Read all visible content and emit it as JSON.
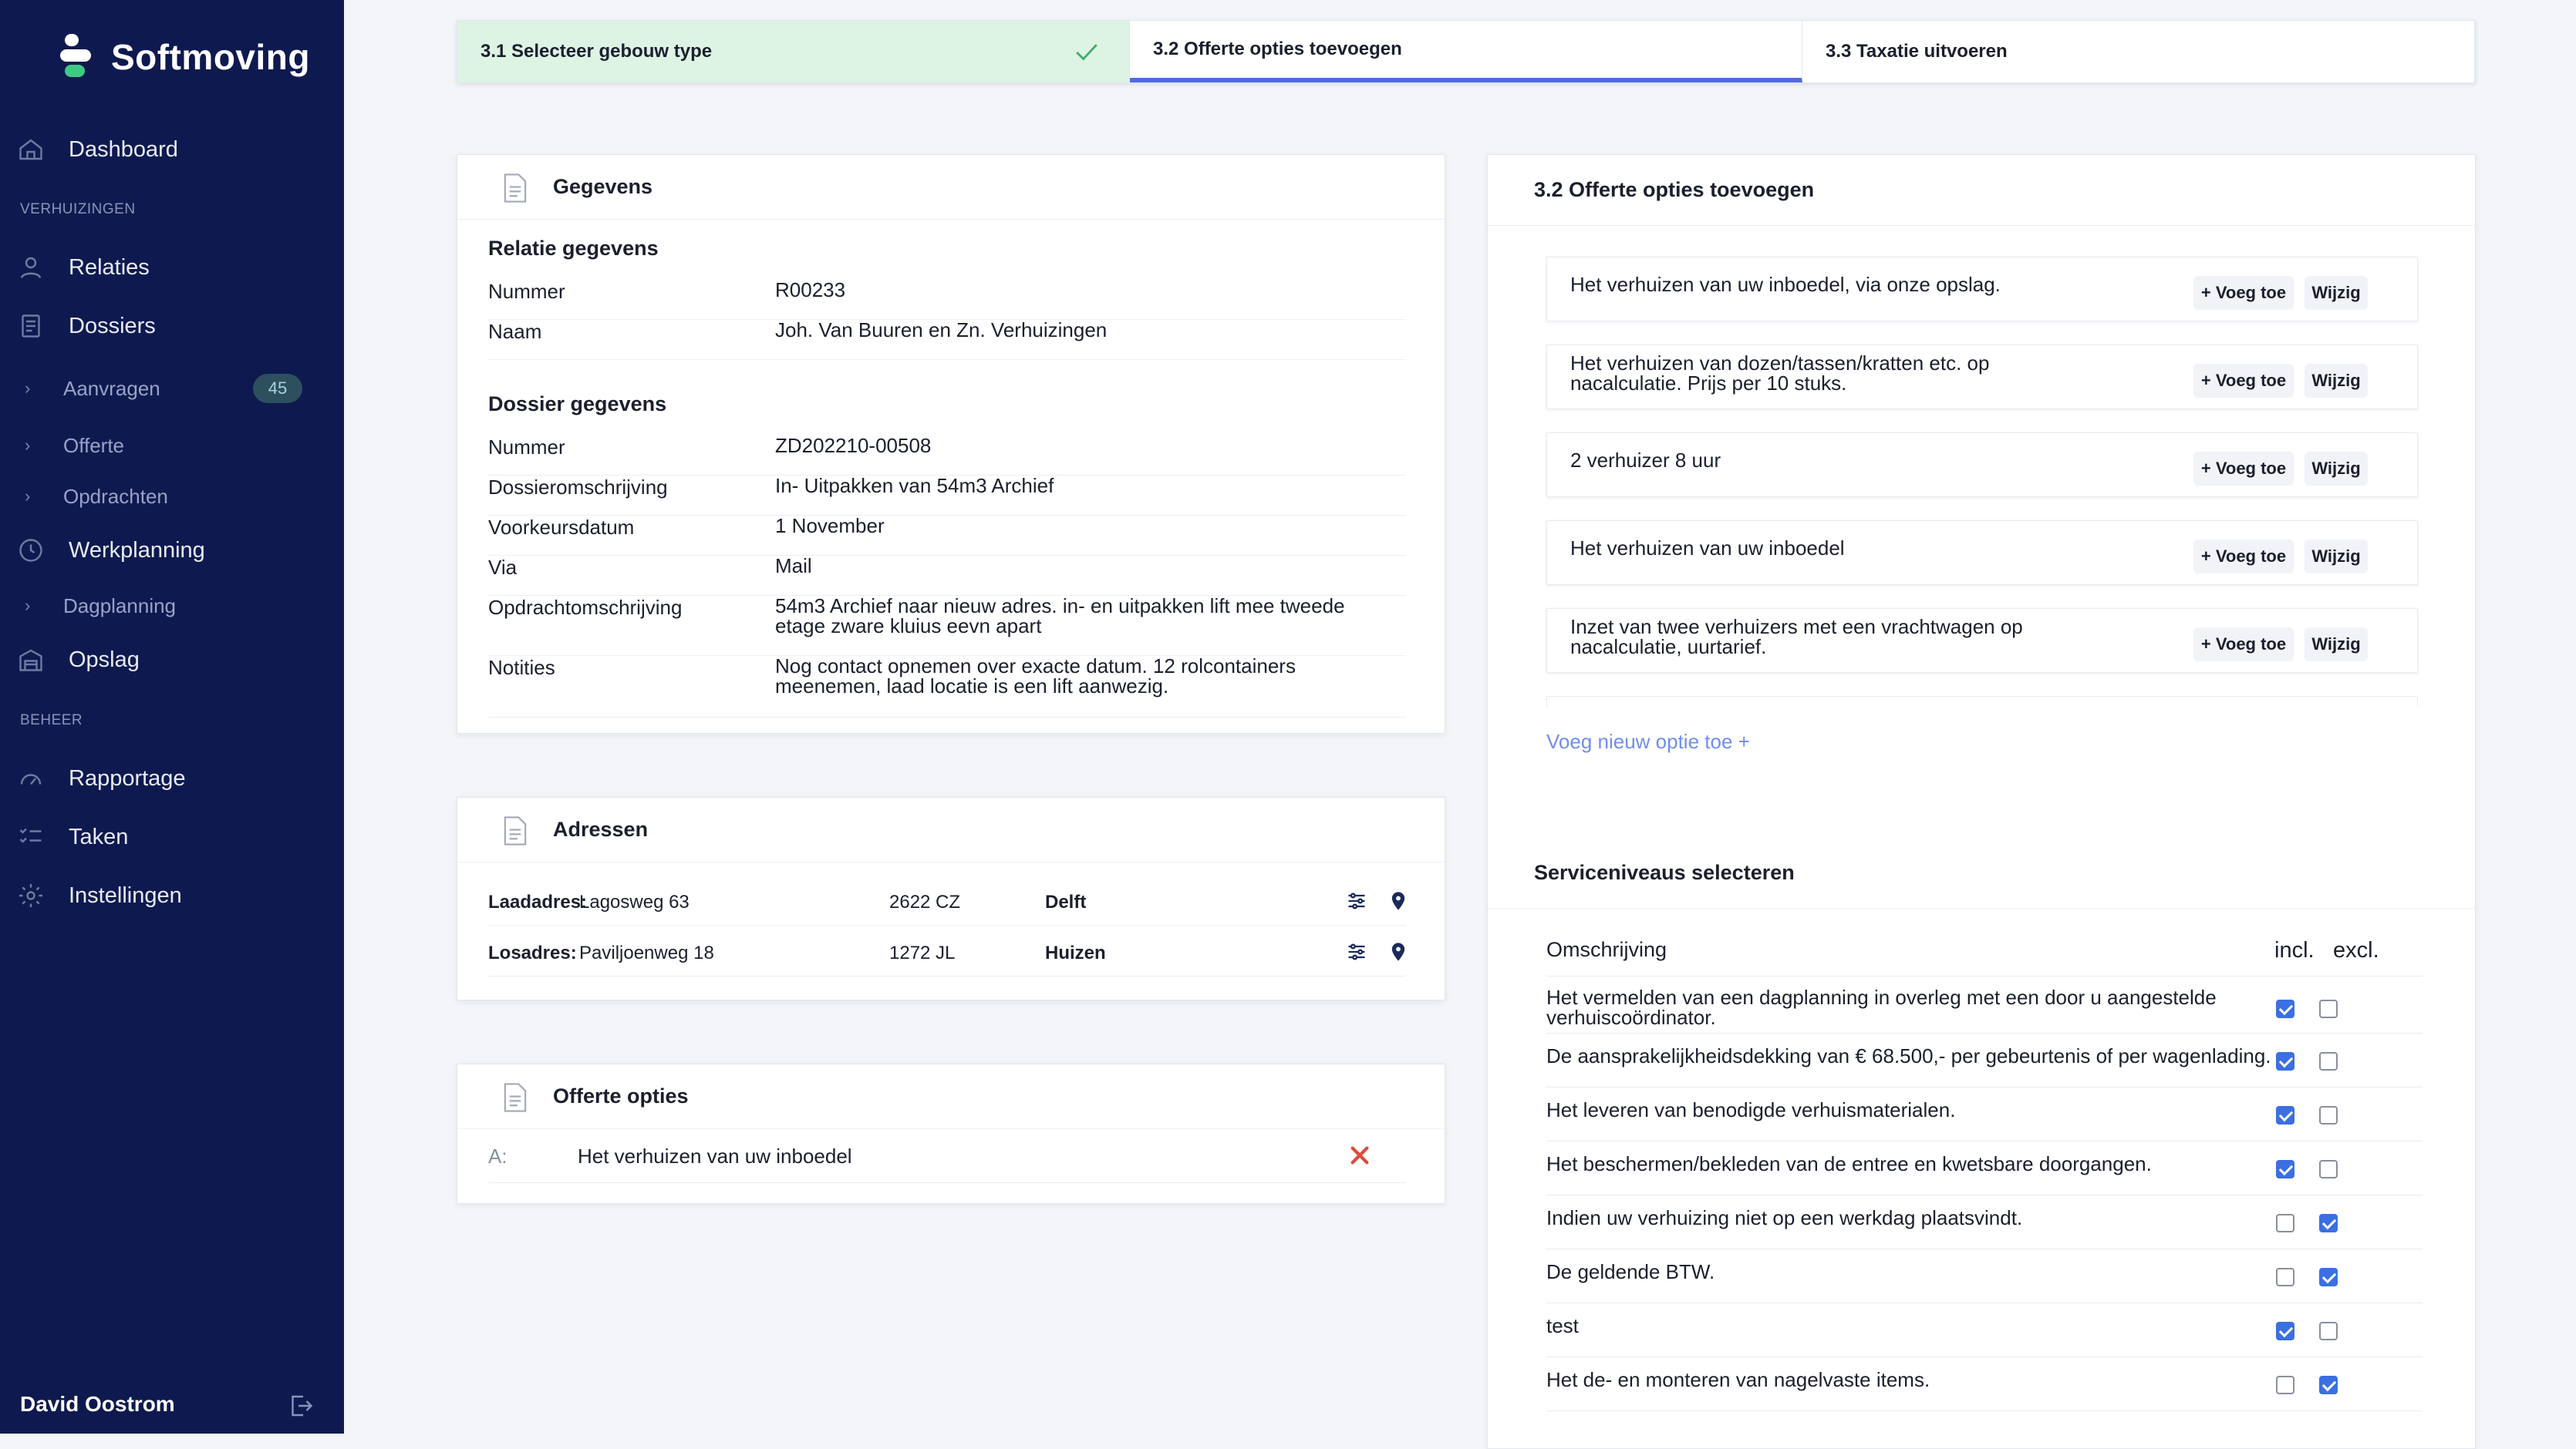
{
  "app": {
    "name": "Softmoving"
  },
  "sidebar": {
    "dashboard": "Dashboard",
    "section_verhuizingen": "VERHUIZINGEN",
    "relaties": "Relaties",
    "dossiers": "Dossiers",
    "aanvragen": "Aanvragen",
    "aanvragen_count": "45",
    "offerte": "Offerte",
    "opdrachten": "Opdrachten",
    "werkplanning": "Werkplanning",
    "dagplanning": "Dagplanning",
    "opslag": "Opslag",
    "section_beheer": "BEHEER",
    "rapportage": "Rapportage",
    "taken": "Taken",
    "instellingen": "Instellingen",
    "user_name": "David Oostrom"
  },
  "stepper": {
    "steps": [
      {
        "label": "3.1 Selecteer gebouw type",
        "state": "done"
      },
      {
        "label": "3.2 Offerte opties toevoegen",
        "state": "active"
      },
      {
        "label": "3.3 Taxatie uitvoeren",
        "state": "todo"
      }
    ]
  },
  "gegevens": {
    "title": "Gegevens",
    "relatie_title": "Relatie gegevens",
    "relatie": [
      {
        "label": "Nummer",
        "value": "R00233"
      },
      {
        "label": "Naam",
        "value": "Joh. Van Buuren en Zn. Verhuizingen"
      }
    ],
    "dossier_title": "Dossier gegevens",
    "dossier": [
      {
        "label": "Nummer",
        "value": "ZD202210-00508"
      },
      {
        "label": "Dossieromschrijving",
        "value": "In- Uitpakken van 54m3 Archief"
      },
      {
        "label": "Voorkeursdatum",
        "value": "1 November"
      },
      {
        "label": "Via",
        "value": "Mail"
      },
      {
        "label": "Opdrachtomschrijving",
        "value": "54m3 Archief naar nieuw adres. in- en uitpakken lift mee tweede etage zware kluius eevn apart"
      },
      {
        "label": "Notities",
        "value": "Nog contact opnemen over exacte datum. 12 rolcontainers meenemen, laad locatie is een lift aanwezig."
      }
    ]
  },
  "adressen": {
    "title": "Adressen",
    "rows": [
      {
        "type": "Laadadres:",
        "street": "Lagosweg 63",
        "postcode": "2622 CZ",
        "city": "Delft"
      },
      {
        "type": "Losadres:",
        "street": "Paviljoenweg 18",
        "postcode": "1272 JL",
        "city": "Huizen"
      }
    ]
  },
  "offerte_opties": {
    "title": "Offerte opties",
    "rows": [
      {
        "letter": "A:",
        "text": "Het verhuizen van uw inboedel"
      }
    ]
  },
  "opties_panel": {
    "title": "3.2 Offerte opties toevoegen",
    "add_label": "+ Voeg toe",
    "edit_label": "Wijzig",
    "options": [
      "Het verhuizen van uw inboedel, via onze opslag.",
      "Het verhuizen van dozen/tassen/kratten etc. op nacalculatie. Prijs per 10 stuks.",
      "2 verhuizer 8 uur",
      "Het verhuizen van uw inboedel",
      "Inzet van twee verhuizers met een vrachtwagen op nacalculatie, uurtarief."
    ],
    "new_option_link": "Voeg nieuw optie toe +"
  },
  "serviceniveaus": {
    "title": "Serviceniveaus selecteren",
    "col_desc": "Omschrijving",
    "col_incl": "incl.",
    "col_excl": "excl.",
    "rows": [
      {
        "text": "Het vermelden van een dagplanning in overleg met een door u aangestelde verhuiscoördinator.",
        "incl": true,
        "excl": false
      },
      {
        "text": "De aansprakelijkheidsdekking van € 68.500,- per gebeurtenis of per wagenlading.",
        "incl": true,
        "excl": false
      },
      {
        "text": "Het leveren van benodigde verhuismaterialen.",
        "incl": true,
        "excl": false
      },
      {
        "text": "Het beschermen/bekleden van de entree en kwetsbare doorgangen.",
        "incl": true,
        "excl": false
      },
      {
        "text": "Indien uw verhuizing niet op een werkdag plaatsvindt.",
        "incl": false,
        "excl": true
      },
      {
        "text": "De geldende BTW.",
        "incl": false,
        "excl": true
      },
      {
        "text": "test",
        "incl": true,
        "excl": false
      },
      {
        "text": "Het de- en monteren van nagelvaste items.",
        "incl": false,
        "excl": true
      }
    ]
  },
  "colors": {
    "sidebar_bg": "#0e1a4f",
    "accent": "#4f6ae6",
    "done_step": "#ddf3e4",
    "checkbox": "#3b6fe2",
    "remove": "#e04a3c",
    "logo_green": "#3ec983"
  }
}
